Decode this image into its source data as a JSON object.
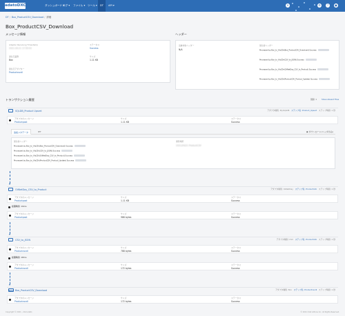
{
  "topbar": {
    "brand": "adatoDXC",
    "nav": [
      {
        "label": "ダッシュボード ▾",
        "active": false
      },
      {
        "label": "ログ ▾",
        "active": false
      },
      {
        "label": "ファイル ▾",
        "active": false
      },
      {
        "label": "ツール ▾",
        "active": false
      },
      {
        "label": "DT",
        "active": true
      },
      {
        "label": "API ▾",
        "active": false
      }
    ]
  },
  "breadcrumb": [
    "DT",
    "Box_ProductCSV_Download",
    "詳細"
  ],
  "page": {
    "title": "Box_ProductCSV_Download"
  },
  "message_info": {
    "heading": "メッセージ情報",
    "fields": [
      {
        "label": "Adapter Receiving Timestamp",
        "value": "2021-04-21 17:55:03",
        "blur": true,
        "link": false
      },
      {
        "label": "ステータス",
        "value": "Success",
        "blur": false,
        "link": true
      },
      {
        "label": "送信元業務",
        "value": "Box",
        "blur": false,
        "link": false
      },
      {
        "label": "サイズ",
        "value": "1.11 KB",
        "blur": false,
        "link": false
      },
      {
        "label": "受信元アダプター",
        "value": "Productcsvdl",
        "blur": false,
        "link": true
      }
    ]
  },
  "header_info": {
    "heading": "ヘッダー",
    "left_label": "追跡対象ヘッダー",
    "left_value": "N/A",
    "right_label": "受信者ヘッダー",
    "rows": [
      "Processed by Box_to_Vtx2Dr(Box_ProductCSV_Download) Success",
      "Processed by Box_to_Vtx2Dr(CSV_to_JSON) Success",
      "Processed by Box_to_Vtx2Dr(OilNetDay_CSV_to_Product) Success",
      "Processed by Box_to_Vtx2Dr(ProductCSV_Product_Update) Success"
    ]
  },
  "transaction": {
    "heading": "トランザクション履歴",
    "filter": "展開: 1",
    "show_all": "Show Absent Files",
    "rows_text": [
      "Processed by Box_to_Vtx2Dr(Box_ProductCSV_Download) Success",
      "Processed by Box_to_Vtx2Dr(CSV_to_JSON) Success",
      "Processed by Box_to_Vtx2Dr(OilNetDay_CSV_to_Product) Success",
      "Processed by Box_to_Vtx2Dr(ProductCSV_Product_Update) Success"
    ]
  },
  "steps": [
    {
      "name": "SQLDB_Product Upsert",
      "type": "アダプタ種別: MySQLDB",
      "time": "ステップ時間: 1 秒",
      "detail": "ステップ名: Product_Upsert",
      "col1_label": "アダプタのメッセージ",
      "col1_value": "Productpost",
      "col2_label": "サイズ",
      "col2_value": "1.11 KB",
      "col3_label": "ステータス",
      "col3_value": "Success"
    },
    {
      "name": "OilNetDay_CSV_to_Product",
      "type": "アダプタ種別: OilNetDay",
      "time": "ステップ時間: 1 秒",
      "detail": "ステップ名: Productinfo",
      "col1_label": "アダプタのメッセージ",
      "col1_value": "Productpost",
      "col2_label": "サイズ",
      "col2_value": "1.11 KB",
      "col3_label": "ステータス",
      "col3_value": "Success"
    },
    {
      "name": "CSV_to_JSON",
      "type": "アダプタ種別: CSV",
      "time": "ステップ時間: 1 秒",
      "detail": "ステップ名: Productinfo",
      "col1_label": "アダプタのメッセージ",
      "col1_value": "Productcsvdl",
      "col2_label": "サイズ",
      "col2_value": "788 bytes",
      "col3_label": "ステータス",
      "col3_value": "Success"
    },
    {
      "name": "Box_ProductCSV_Download",
      "type": "アダプタ種別: Box",
      "time": "ステップ時間: 1 秒",
      "detail": "ステップ名: Productcsvdl",
      "col1_label": "アダプタのメッセージ",
      "col1_value": "Productcsvdl",
      "col2_label": "サイズ",
      "col2_value": "172 bytes",
      "col3_label": "ステータス",
      "col3_value": "Success"
    }
  ],
  "step1_panel": {
    "tabs": [
      "追加メタデータ",
      "IET"
    ],
    "link": "ダウンロード(ヘッダのみ)",
    "left_label": "受信者ヘッダー",
    "right_label": "保存場所",
    "right_value": "2021/04/21 ProductCSV"
  },
  "waits": [
    {
      "label": "処理時間: 19ms"
    },
    {
      "label": "処理時間: 18ms"
    }
  ],
  "extra_rows": [
    {
      "col1_label": "アダプタのメッセージ",
      "col1_value": "Productpost",
      "col2_label": "サイズ",
      "col2_value": "986 bytes",
      "col3_label": "ステータス",
      "col3_value": "Success"
    },
    {
      "col1_label": "アダプタのメッセージ",
      "col1_value": "Productcsvdl",
      "col2_label": "サイズ",
      "col2_value": "172 bytes",
      "col3_label": "ステータス",
      "col3_value": "Success"
    }
  ],
  "footer": {
    "left": "Copyright © 2021 - 21st adato",
    "right": "© 2021 21st Adtone Inc. All Rights Reserved."
  }
}
